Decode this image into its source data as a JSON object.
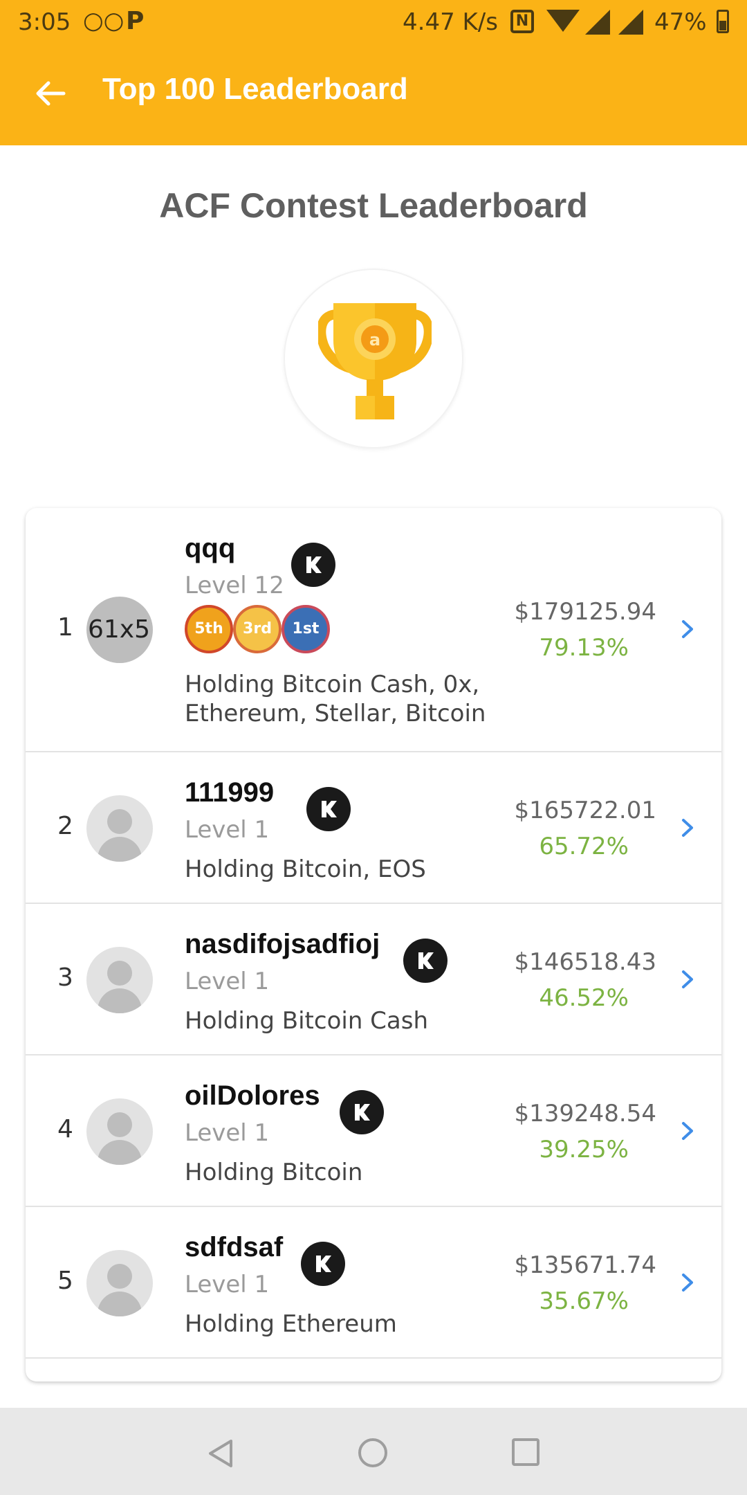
{
  "status_bar": {
    "time": "3:05",
    "voicemail_icon": "voicemail-icon",
    "app_icon": "P",
    "net_speed": "4.47 K/s",
    "nfc": "N",
    "battery": "47%"
  },
  "appbar": {
    "title": "Top 100 Leaderboard",
    "back_icon": "arrow-back-icon"
  },
  "contest": {
    "title": "ACF Contest Leaderboard",
    "trophy_icon": "trophy-icon"
  },
  "colors": {
    "accent": "#fbb316",
    "positive": "#7cb342",
    "chevron": "#3f8de8"
  },
  "entries": [
    {
      "rank": "1",
      "avatar_placeholder": "61x57",
      "username": "qqq",
      "level": "Level 12",
      "medals": [
        "5th",
        "3rd",
        "1st"
      ],
      "holding": "Holding Bitcoin Cash, 0x, Ethereum, Stellar, Bitcoin",
      "amount": "$179125.94",
      "percent": "79.13%"
    },
    {
      "rank": "2",
      "username": "111999",
      "level": "Level 1",
      "holding": "Holding Bitcoin, EOS",
      "amount": "$165722.01",
      "percent": "65.72%"
    },
    {
      "rank": "3",
      "username": "nasdifojsadfioj",
      "level": "Level 1",
      "holding": "Holding Bitcoin Cash",
      "amount": "$146518.43",
      "percent": "46.52%"
    },
    {
      "rank": "4",
      "username": "oilDolores",
      "level": "Level 1",
      "holding": "Holding Bitcoin",
      "amount": "$139248.54",
      "percent": "39.25%"
    },
    {
      "rank": "5",
      "username": "sdfdsaf",
      "level": "Level 1",
      "holding": "Holding Ethereum",
      "amount": "$135671.74",
      "percent": "35.67%"
    }
  ]
}
